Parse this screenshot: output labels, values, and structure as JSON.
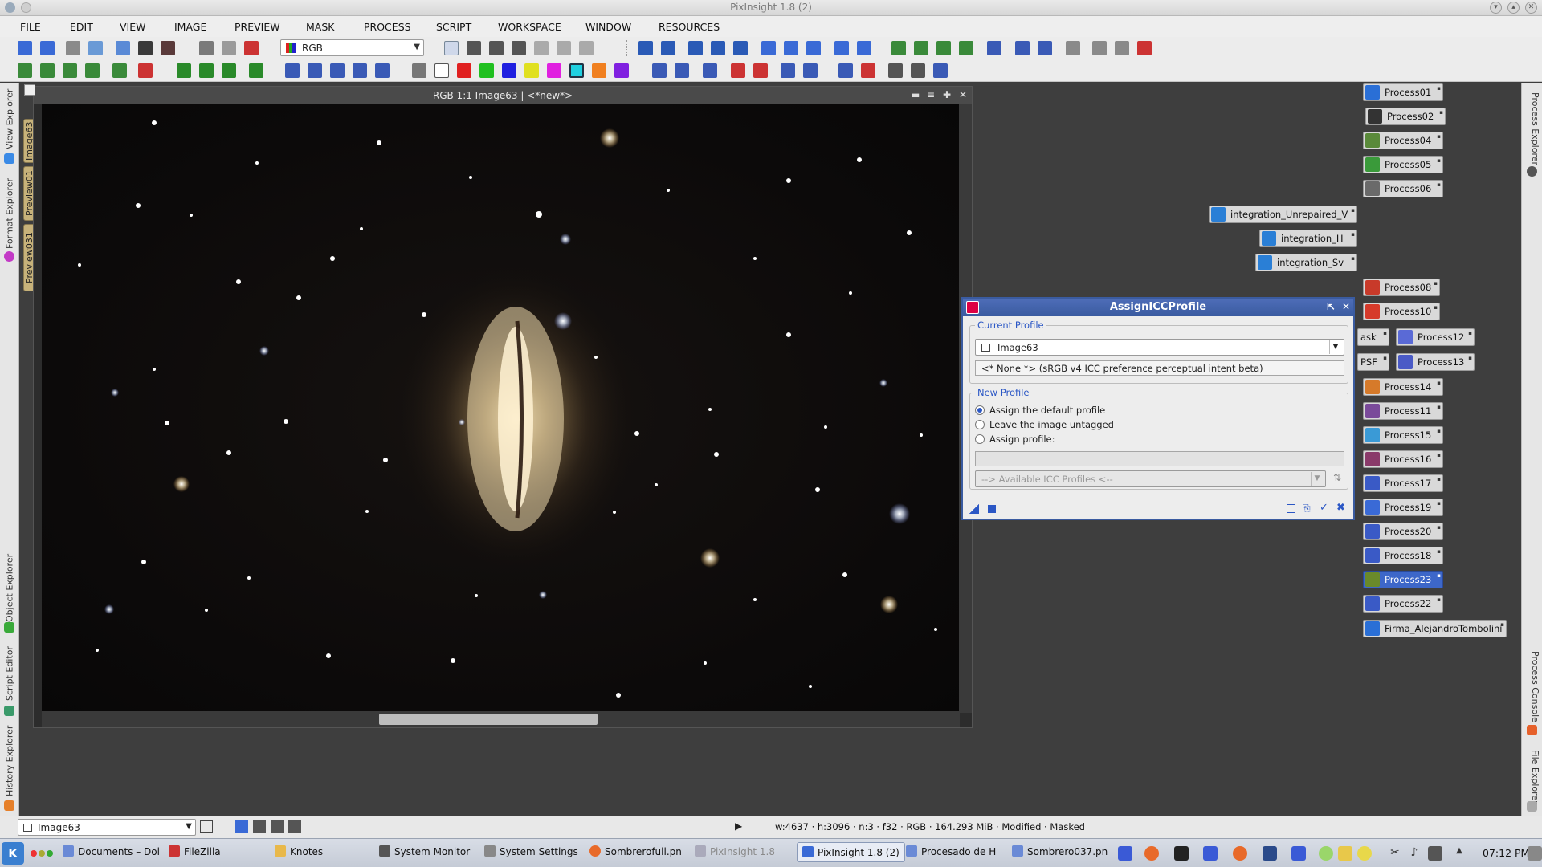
{
  "window": {
    "title": "PixInsight 1.8 (2)"
  },
  "menubar": {
    "items": [
      "FILE",
      "EDIT",
      "VIEW",
      "IMAGE",
      "PREVIEW",
      "MASK",
      "PROCESS",
      "SCRIPT",
      "WORKSPACE",
      "WINDOW",
      "RESOURCES"
    ]
  },
  "toolbar": {
    "channel_select": "RGB"
  },
  "left_dock": {
    "tabs": [
      "View Explorer",
      "Format Explorer",
      "Object Explorer",
      "Script Editor",
      "History Explorer"
    ]
  },
  "image_tabs": [
    "Image63",
    "Preview01",
    "Preview031"
  ],
  "right_dock": {
    "tabs": [
      "Process Explorer",
      "Process Console",
      "File Explorer"
    ]
  },
  "image_window": {
    "title": "RGB 1:1 Image63 | <*new*>"
  },
  "dialog": {
    "title": "AssignICCProfile",
    "current_profile": {
      "legend": "Current Profile",
      "image": "Image63",
      "profile_text": "<* None *> (sRGB v4 ICC preference perceptual intent beta)"
    },
    "new_profile": {
      "legend": "New Profile",
      "options": [
        {
          "label": "Assign the default profile",
          "selected": true
        },
        {
          "label": "Leave the image untagged",
          "selected": false
        },
        {
          "label": "Assign profile:",
          "selected": false
        }
      ],
      "profile_field": "",
      "available_profiles": "--> Available ICC Profiles <--"
    }
  },
  "process_icons": [
    {
      "label": "Process01",
      "color": "#2a6fd6"
    },
    {
      "label": "Process02",
      "color": "#333333"
    },
    {
      "label": "Process04",
      "color": "#5a8a3a"
    },
    {
      "label": "Process05",
      "color": "#3a9a3a"
    },
    {
      "label": "Process06",
      "color": "#6a6a6a"
    },
    {
      "label": "integration_Unrepaired_V",
      "color": "#2a7fd6"
    },
    {
      "label": "integration_H",
      "color": "#2a7fd6"
    },
    {
      "label": "integration_Sv",
      "color": "#2a7fd6"
    },
    {
      "label": "Process08",
      "color": "#c83a2a"
    },
    {
      "label": "Process10",
      "color": "#d63a2a"
    },
    {
      "label": "ask",
      "color": "#888888"
    },
    {
      "label": "Process12",
      "color": "#5a6ad6"
    },
    {
      "label": "PSF",
      "color": "#888888"
    },
    {
      "label": "Process13",
      "color": "#4a5ac6"
    },
    {
      "label": "Process14",
      "color": "#d67a2a"
    },
    {
      "label": "Process11",
      "color": "#7a4a9a"
    },
    {
      "label": "Process15",
      "color": "#3a9ad6"
    },
    {
      "label": "Process16",
      "color": "#8a3a6a"
    },
    {
      "label": "Process17",
      "color": "#3a5ac6"
    },
    {
      "label": "Process19",
      "color": "#3a6ad6"
    },
    {
      "label": "Process20",
      "color": "#3a5ac6"
    },
    {
      "label": "Process18",
      "color": "#3a5ac6"
    },
    {
      "label": "Process23",
      "color": "#6a8a2a",
      "selected": true
    },
    {
      "label": "Process22",
      "color": "#3a5ac6"
    },
    {
      "label": "Firma_AlejandroTombolini",
      "color": "#2a6fd6"
    }
  ],
  "statusbar": {
    "view": "Image63",
    "info": "w:4637 · h:3096 · n:3 · f32 · RGB · 164.293 MiB · Modified · Masked"
  },
  "taskbar": {
    "items": [
      {
        "label": "Documents – Dol",
        "active": false,
        "dim": false
      },
      {
        "label": "FileZilla",
        "active": false,
        "dim": false
      },
      {
        "label": "Knotes",
        "active": false,
        "dim": false
      },
      {
        "label": "System Monitor",
        "active": false,
        "dim": false
      },
      {
        "label": "System Settings",
        "active": false,
        "dim": false
      },
      {
        "label": "Sombrerofull.pn",
        "active": false,
        "dim": false
      },
      {
        "label": "PixInsight 1.8",
        "active": false,
        "dim": true
      },
      {
        "label": "PixInsight 1.8 (2)",
        "active": true,
        "dim": false
      },
      {
        "label": "Procesado de H",
        "active": false,
        "dim": false
      },
      {
        "label": "Sombrero037.pn",
        "active": false,
        "dim": false
      }
    ],
    "clock": "07:12 PM"
  }
}
